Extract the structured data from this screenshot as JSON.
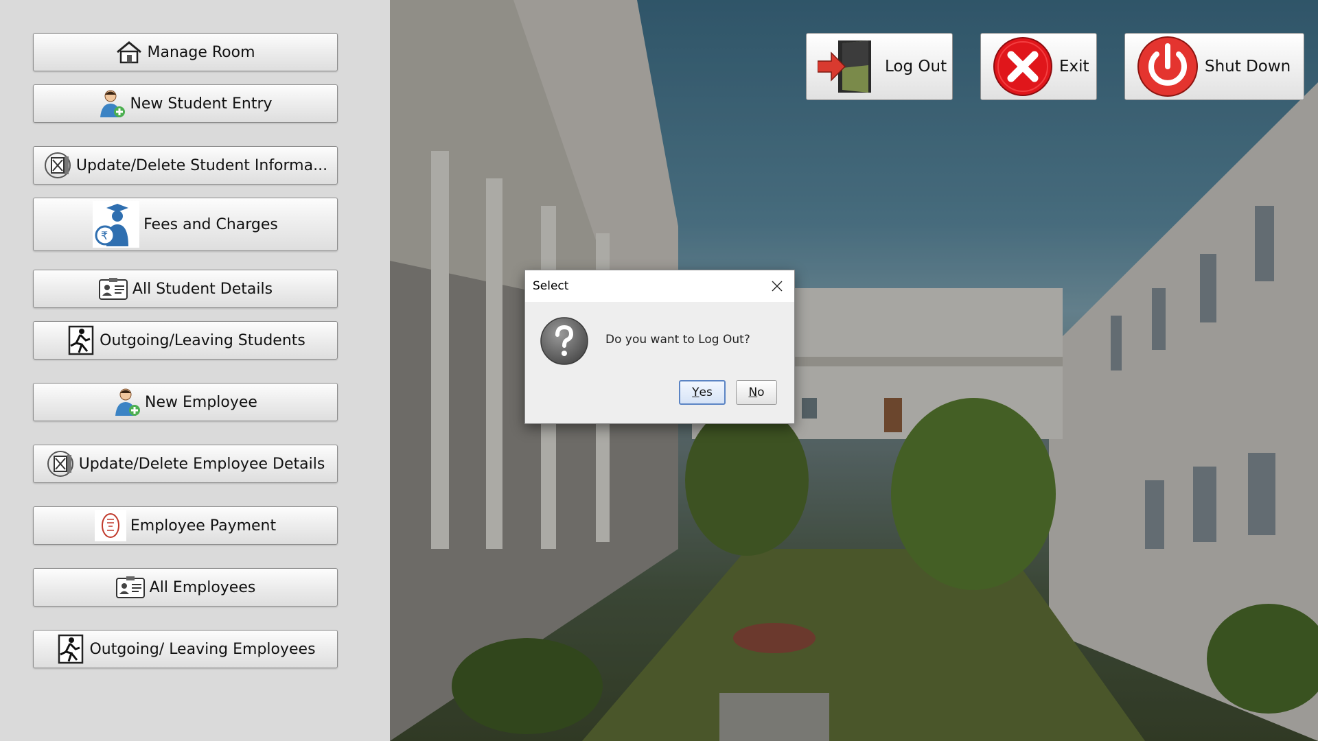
{
  "sidebar": {
    "items": [
      {
        "label": "Manage Room",
        "icon": "house-icon"
      },
      {
        "label": "New Student Entry",
        "icon": "add-user-icon"
      },
      {
        "label": "Update/Delete Student Informa...",
        "icon": "edit-document-icon"
      },
      {
        "label": "Fees and Charges",
        "icon": "student-fees-icon"
      },
      {
        "label": "All Student Details",
        "icon": "id-card-icon"
      },
      {
        "label": "Outgoing/Leaving Students",
        "icon": "exit-running-icon"
      },
      {
        "label": "New Employee",
        "icon": "add-user-icon"
      },
      {
        "label": "Update/Delete Employee Details",
        "icon": "edit-document-icon"
      },
      {
        "label": "Employee Payment",
        "icon": "payment-receipt-icon"
      },
      {
        "label": "All Employees",
        "icon": "id-card-icon"
      },
      {
        "label": "Outgoing/ Leaving Employees",
        "icon": "exit-running-icon"
      }
    ]
  },
  "top_actions": {
    "logout_label": "Log Out",
    "exit_label": "Exit",
    "shutdown_label": "Shut Down"
  },
  "dialog": {
    "title": "Select",
    "message": "Do you want to Log Out?",
    "yes_first": "Y",
    "yes_rest": "es",
    "no_first": "N",
    "no_rest": "o"
  },
  "colors": {
    "sidebar_bg": "#dadada",
    "exit_red": "#e0161b",
    "shutdown_red": "#e4342f",
    "dialog_bg": "#eeeeee",
    "default_button_border": "#5b84c4"
  }
}
